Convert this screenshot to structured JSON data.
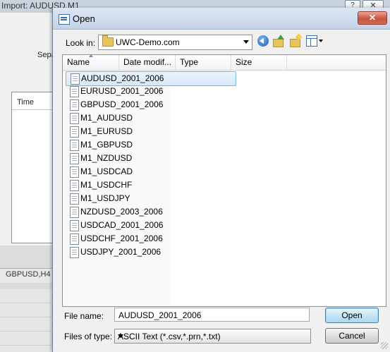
{
  "background_window": {
    "title": "Import: AUDUSD,M1",
    "separator_label": "Sepa",
    "column_time": "Time",
    "chart_tab": "GBPUSD,H4",
    "help_glyph": "?",
    "close_glyph": "✕"
  },
  "dialog": {
    "title": "Open",
    "close_glyph": "✕",
    "look_in_label": "Look in:",
    "look_in_value": "UWC-Demo.com",
    "columns": [
      "Name",
      "Date modif...",
      "Type",
      "Size"
    ],
    "files": [
      "AUDUSD_2001_2006",
      "EURUSD_2001_2006",
      "GBPUSD_2001_2006",
      "M1_AUDUSD",
      "M1_EURUSD",
      "M1_GBPUSD",
      "M1_NZDUSD",
      "M1_USDCAD",
      "M1_USDCHF",
      "M1_USDJPY",
      "NZDUSD_2003_2006",
      "USDCAD_2001_2006",
      "USDCHF_2001_2006",
      "USDJPY_2001_2006"
    ],
    "selected_index": 0,
    "file_name_label": "File name:",
    "file_name_value": "AUDUSD_2001_2006",
    "file_type_label": "Files of type:",
    "file_type_value": "ASCII Text (*.csv,*.prn,*.txt)",
    "open_button": "Open",
    "cancel_button": "Cancel",
    "toolbar_icons": [
      "back-icon",
      "up-folder-icon",
      "new-folder-icon",
      "views-icon"
    ]
  }
}
